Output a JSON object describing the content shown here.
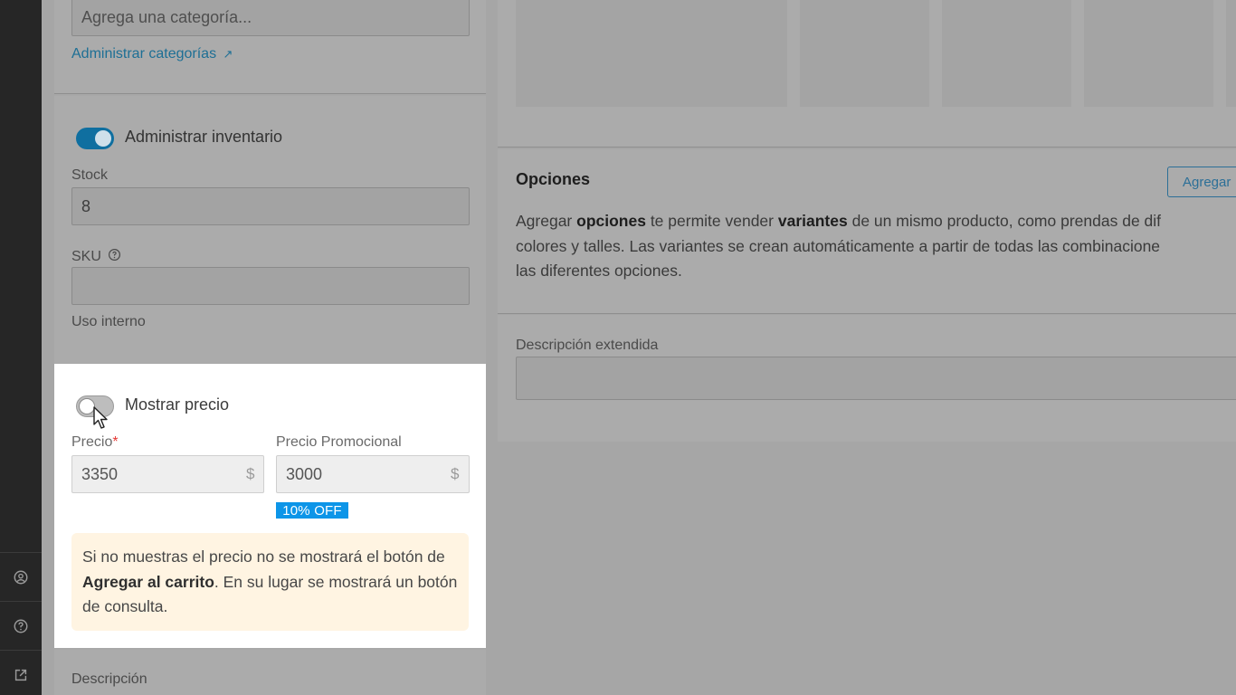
{
  "sidebar_icons": [
    "account-circle-icon",
    "help-circle-icon",
    "open-external-icon"
  ],
  "categories": {
    "placeholder": "Agrega una categoría...",
    "manage_link": "Administrar categorías",
    "manage_link_icon": "↗"
  },
  "inventory": {
    "toggle_label": "Administrar inventario",
    "toggle_on": true,
    "stock_label": "Stock",
    "stock_value": "8",
    "sku_label": "SKU",
    "sku_help_icon": "question-circle-icon",
    "sku_value": "",
    "sku_hint": "Uso interno"
  },
  "pricing": {
    "toggle_label": "Mostrar precio",
    "toggle_on": false,
    "price_label": "Precio",
    "required_mark": "*",
    "price_value": "3350",
    "currency": "$",
    "promo_label": "Precio Promocional",
    "promo_value": "3000",
    "discount_badge": "10% OFF",
    "notice_part1": "Si no muestras el precio no se mostrará el botón de ",
    "notice_bold": "Agregar al carrito",
    "notice_part2": ". En su lugar se mostrará un botón de consulta."
  },
  "description": {
    "label": "Descripción"
  },
  "options": {
    "title": "Opciones",
    "add_button": "Agregar",
    "text_1": "Agregar ",
    "text_bold_1": "opciones",
    "text_2": " te permite vender ",
    "text_bold_2": "variantes",
    "text_3": " de un mismo producto, como prendas de dif",
    "text_line2": "colores y talles. Las variantes se crean automáticamente a partir de todas las combinacione",
    "text_line3": "las diferentes opciones."
  },
  "extended_description": {
    "label": "Descripción extendida"
  },
  "colors": {
    "toggle_on": "#0f6fa0",
    "badge": "#0d95e8",
    "notice_bg": "#fff4e2",
    "required": "#e53935"
  }
}
